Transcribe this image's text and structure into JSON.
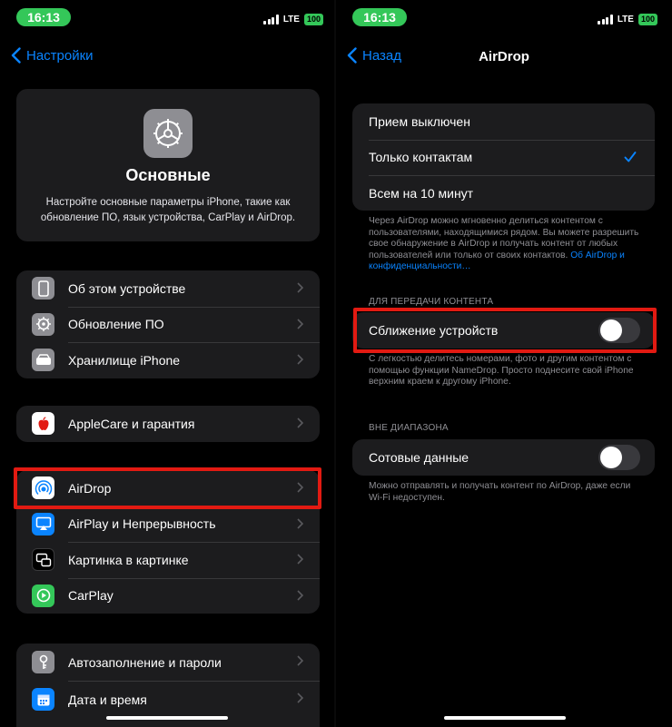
{
  "status": {
    "time": "16:13",
    "network": "LTE",
    "battery": "100"
  },
  "left": {
    "back_label": "Настройки",
    "hero": {
      "icon": "gear-icon",
      "title": "Основные",
      "description": "Настройте основные параметры iPhone, такие как обновление ПО, язык устройства, CarPlay и AirDrop."
    },
    "group1": [
      {
        "label": "Об этом устройстве",
        "icon": "phone-icon",
        "color": "#8e8e93"
      },
      {
        "label": "Обновление ПО",
        "icon": "gear-icon",
        "color": "#8e8e93"
      },
      {
        "label": "Хранилище iPhone",
        "icon": "storage-icon",
        "color": "#8e8e93"
      }
    ],
    "group2": [
      {
        "label": "AppleCare и гарантия",
        "icon": "apple-icon",
        "color": "#ffffff"
      }
    ],
    "group3": [
      {
        "label": "AirDrop",
        "icon": "airdrop-icon",
        "color": "#ffffff"
      },
      {
        "label": "AirPlay и Непрерывность",
        "icon": "airplay-icon",
        "color": "#0a84ff"
      },
      {
        "label": "Картинка в картинке",
        "icon": "pip-icon",
        "color": "#1c1c1e"
      },
      {
        "label": "CarPlay",
        "icon": "carplay-icon",
        "color": "#34c759"
      }
    ],
    "group4": [
      {
        "label": "Автозаполнение и пароли",
        "icon": "key-icon",
        "color": "#8e8e93"
      },
      {
        "label": "Дата и время",
        "icon": "calendar-icon",
        "color": "#0a84ff"
      }
    ]
  },
  "right": {
    "back_label": "Назад",
    "title": "AirDrop",
    "options": [
      {
        "label": "Прием выключен",
        "selected": false
      },
      {
        "label": "Только контактам",
        "selected": true
      },
      {
        "label": "Всем на 10 минут",
        "selected": false
      }
    ],
    "options_footer": "Через AirDrop можно мгновенно делиться контентом с пользователями, находящимися рядом. Вы можете разрешить свое обнаружение в AirDrop и получать контент от любых пользователей или только от своих контактов.",
    "options_footer_link": "Об AirDrop и конфиденциальности…",
    "section_content": "ДЛЯ ПЕРЕДАЧИ КОНТЕНТА",
    "bring_devices": {
      "label": "Сближение устройств",
      "on": false
    },
    "bring_footer": "С легкостью делитесь номерами, фото и другим контентом с помощью функции NameDrop. Просто поднесите свой iPhone верхним краем к другому iPhone.",
    "section_range": "ВНЕ ДИАПАЗОНА",
    "cellular": {
      "label": "Сотовые данные",
      "on": false
    },
    "cellular_footer": "Можно отправлять и получать контент по AirDrop, даже если Wi-Fi недоступен."
  },
  "colors": {
    "accent": "#0a84ff",
    "highlight": "#e21a12",
    "green": "#34c759"
  }
}
